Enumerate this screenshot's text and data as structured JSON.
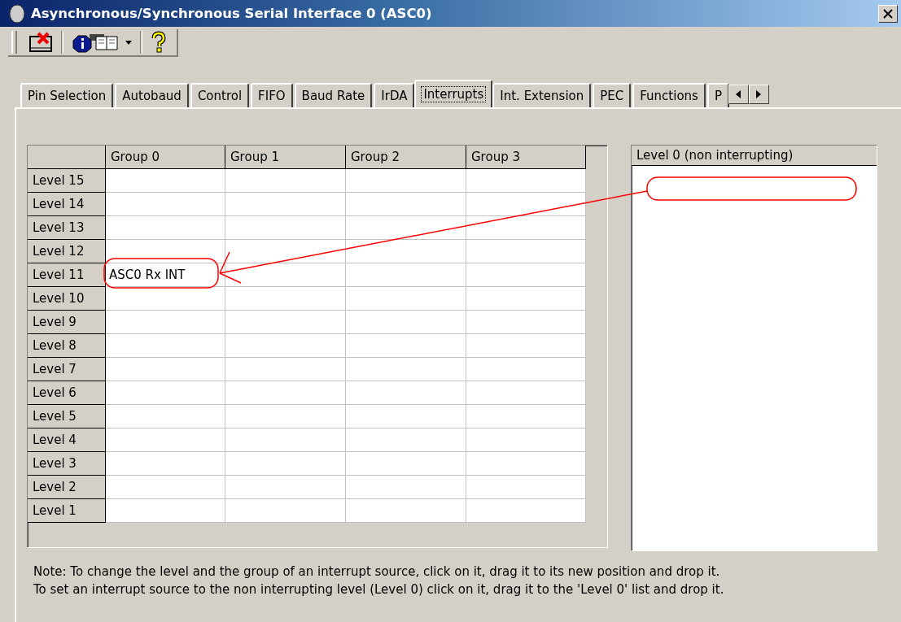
{
  "window": {
    "title": "Asynchronous/Synchronous Serial Interface 0 (ASC0)"
  },
  "toolbar": {
    "buttons": [
      {
        "kind": "close"
      },
      {
        "kind": "info",
        "has_dropdown": true
      },
      {
        "kind": "help"
      }
    ]
  },
  "tabs": [
    {
      "label": "Pin Selection",
      "selected": false
    },
    {
      "label": "Autobaud",
      "selected": false
    },
    {
      "label": "Control",
      "selected": false
    },
    {
      "label": "FIFO",
      "selected": false
    },
    {
      "label": "Baud Rate",
      "selected": false
    },
    {
      "label": "IrDA",
      "selected": false
    },
    {
      "label": "Interrupts",
      "selected": true
    },
    {
      "label": "Int. Extension",
      "selected": false
    },
    {
      "label": "PEC",
      "selected": false
    },
    {
      "label": "Functions",
      "selected": false
    },
    {
      "label": "P",
      "selected": false
    }
  ],
  "interrupt_grid": {
    "columns": [
      "Group 0",
      "Group 1",
      "Group 2",
      "Group 3"
    ],
    "rows": [
      {
        "label": "Level 15",
        "cells": [
          null,
          null,
          null,
          null
        ]
      },
      {
        "label": "Level 14",
        "cells": [
          null,
          null,
          null,
          null
        ]
      },
      {
        "label": "Level 13",
        "cells": [
          null,
          null,
          null,
          null
        ]
      },
      {
        "label": "Level 12",
        "cells": [
          null,
          null,
          null,
          null
        ]
      },
      {
        "label": "Level 11",
        "cells": [
          {
            "text": "ASC0 Rx INT",
            "circled": true
          },
          null,
          null,
          null
        ]
      },
      {
        "label": "Level 10",
        "cells": [
          null,
          null,
          null,
          null
        ]
      },
      {
        "label": "Level 9",
        "cells": [
          null,
          null,
          null,
          null
        ]
      },
      {
        "label": "Level 8",
        "cells": [
          null,
          null,
          null,
          null
        ]
      },
      {
        "label": "Level 7",
        "cells": [
          null,
          null,
          null,
          null
        ]
      },
      {
        "label": "Level 6",
        "cells": [
          null,
          null,
          null,
          null
        ]
      },
      {
        "label": "Level 5",
        "cells": [
          null,
          null,
          null,
          null
        ]
      },
      {
        "label": "Level 4",
        "cells": [
          null,
          null,
          null,
          null
        ]
      },
      {
        "label": "Level 3",
        "cells": [
          null,
          null,
          null,
          null
        ]
      },
      {
        "label": "Level 2",
        "cells": [
          null,
          null,
          null,
          null
        ]
      },
      {
        "label": "Level 1",
        "cells": [
          null,
          null,
          null,
          null
        ]
      }
    ]
  },
  "level0_list": {
    "header": "Level 0 (non interrupting)",
    "circled_slot": true
  },
  "drag_arrow": true,
  "note": [
    "Note: To change the level and the group of an interrupt source, click on it, drag it to its new position and drop it.",
    "To set an interrupt source to the non interrupting level (Level 0) click on it, drag it to the 'Level 0' list and drop it."
  ]
}
